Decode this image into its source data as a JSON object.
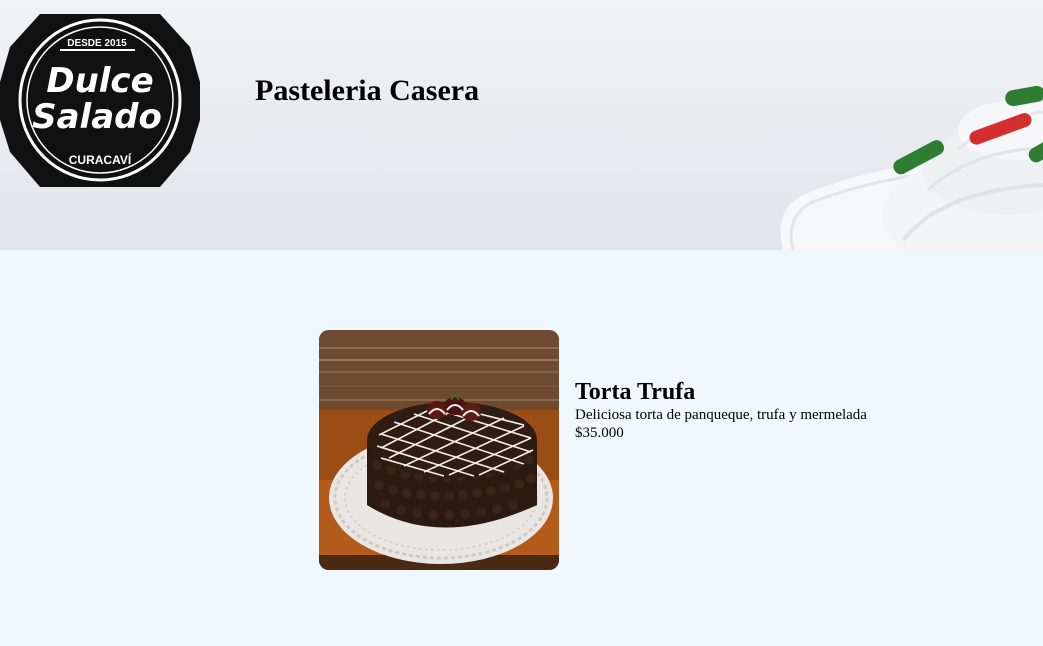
{
  "header": {
    "logo_top": "DESDE 2015",
    "logo_line1": "Dulce",
    "logo_line2": "Salado",
    "logo_bottom": "CURACAVÍ",
    "title": "Pasteleria Casera"
  },
  "products": [
    {
      "name": "Torta Trufa",
      "description": "Deliciosa torta de panqueque, trufa y mermelada",
      "price": "$35.000"
    }
  ],
  "colors": {
    "page_background": "#f0f8ff",
    "logo_dark": "#111111",
    "sprinkle_green": "#2e7d32",
    "sprinkle_red": "#d32f2f"
  }
}
